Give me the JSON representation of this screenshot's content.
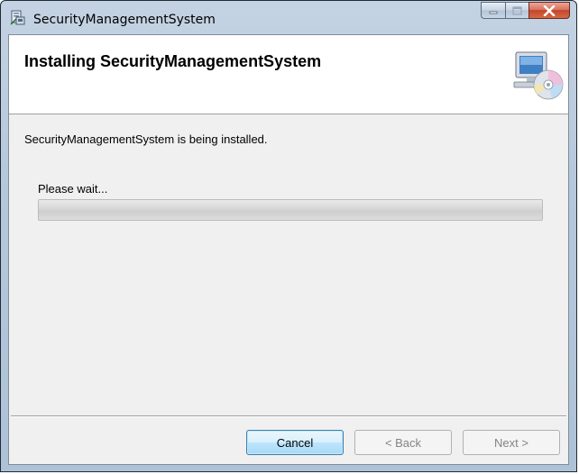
{
  "window": {
    "title": "SecurityManagementSystem"
  },
  "banner": {
    "title": "Installing SecurityManagementSystem",
    "icon": "computer-cd-icon"
  },
  "body": {
    "status": "SecurityManagementSystem is being installed.",
    "wait_label": "Please wait...",
    "progress": 0
  },
  "buttons": {
    "cancel": "Cancel",
    "back": "< Back",
    "next": "Next >"
  },
  "colors": {
    "client_bg": "#f0f0f0",
    "banner_bg": "#ffffff",
    "close_button": "#c4452b",
    "default_button_border": "#3c7fb1"
  }
}
